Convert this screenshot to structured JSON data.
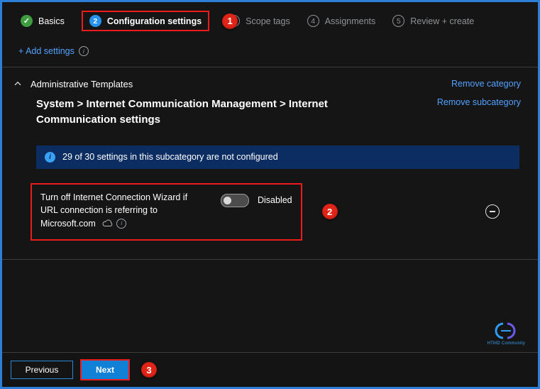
{
  "wizard": {
    "steps": [
      {
        "label": "Basics"
      },
      {
        "label": "Configuration settings",
        "number": "2"
      },
      {
        "label": "Scope tags",
        "number": "3"
      },
      {
        "label": "Assignments",
        "number": "4"
      },
      {
        "label": "Review + create",
        "number": "5"
      }
    ]
  },
  "toolbar": {
    "add_settings_label": "+ Add settings"
  },
  "category": {
    "title": "Administrative Templates",
    "remove_category_label": "Remove category",
    "subcategory_heading": "System > Internet Communication Management > Internet Communication settings",
    "remove_subcategory_label": "Remove subcategory"
  },
  "info_banner": {
    "text": "29 of 30 settings in this subcategory are not configured"
  },
  "setting": {
    "label": "Turn off Internet Connection Wizard if URL connection is referring to Microsoft.com",
    "state_label": "Disabled"
  },
  "annotations": {
    "one": "1",
    "two": "2",
    "three": "3"
  },
  "footer": {
    "previous_label": "Previous",
    "next_label": "Next"
  },
  "logo": {
    "caption": "HTMD Community"
  },
  "icons": {
    "check": "✓",
    "info": "i"
  },
  "colors": {
    "accent_blue": "#2693f0",
    "link_blue": "#53a1ff",
    "annotation_red": "#e02417",
    "banner_bg": "#0b2d61",
    "success_green": "#3f9c3f",
    "frame_border": "#2b7fd9"
  }
}
